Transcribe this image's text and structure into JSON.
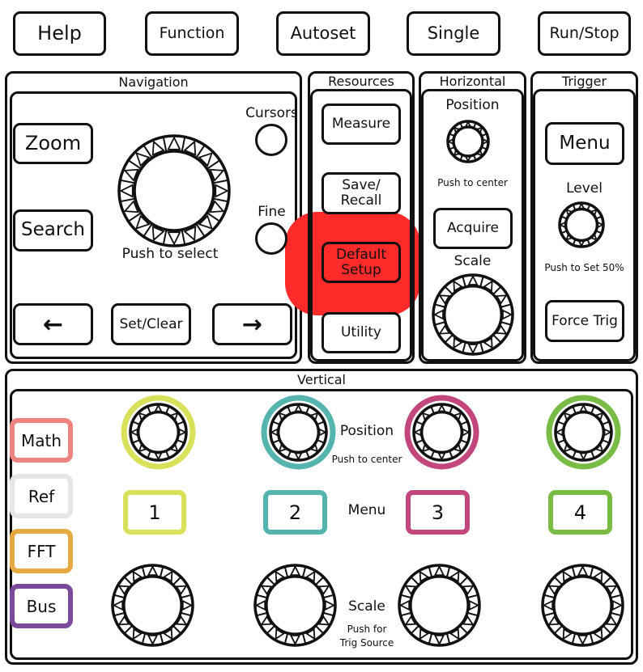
{
  "top_buttons": [
    {
      "label": "Help"
    },
    {
      "label": "Function"
    },
    {
      "label": "Autoset"
    },
    {
      "label": "Single"
    },
    {
      "label": "Run/Stop"
    }
  ],
  "navigation": {
    "title": "Navigation",
    "zoom_label": "Zoom",
    "search_label": "Search",
    "knob_caption": "Push to select",
    "cursors_label": "Cursors",
    "fine_label": "Fine",
    "left_arrow": "←",
    "set_clear_label": "Set/Clear",
    "right_arrow": "→"
  },
  "resources": {
    "title": "Resources",
    "measure_label": "Measure",
    "save_recall_line1": "Save/",
    "save_recall_line2": "Recall",
    "default_setup_line1": "Default",
    "default_setup_line2": "Setup",
    "utility_label": "Utility",
    "highlight_color": "#ff2a2a"
  },
  "horizontal": {
    "title": "Horizontal",
    "position_label": "Position",
    "position_caption": "Push to center",
    "acquire_label": "Acquire",
    "scale_label": "Scale"
  },
  "trigger": {
    "title": "Trigger",
    "menu_label": "Menu",
    "level_label": "Level",
    "level_caption": "Push to Set 50%",
    "force_trig_label": "Force Trig"
  },
  "vertical": {
    "title": "Vertical",
    "position_label": "Position",
    "position_caption": "Push to center",
    "menu_label": "Menu",
    "scale_label": "Scale",
    "scale_caption_line1": "Push for",
    "scale_caption_line2": "Trig Source",
    "side_buttons": [
      {
        "label": "Math",
        "color": "#ee8480"
      },
      {
        "label": "Ref",
        "color": "#e6e6e6"
      },
      {
        "label": "FFT",
        "color": "#e5aa44"
      },
      {
        "label": "Bus",
        "color": "#7b4a9a"
      }
    ],
    "channels": [
      {
        "label": "1",
        "color": "#d9e05a"
      },
      {
        "label": "2",
        "color": "#55b5ae"
      },
      {
        "label": "3",
        "color": "#c2477c"
      },
      {
        "label": "4",
        "color": "#79bc45"
      }
    ]
  }
}
